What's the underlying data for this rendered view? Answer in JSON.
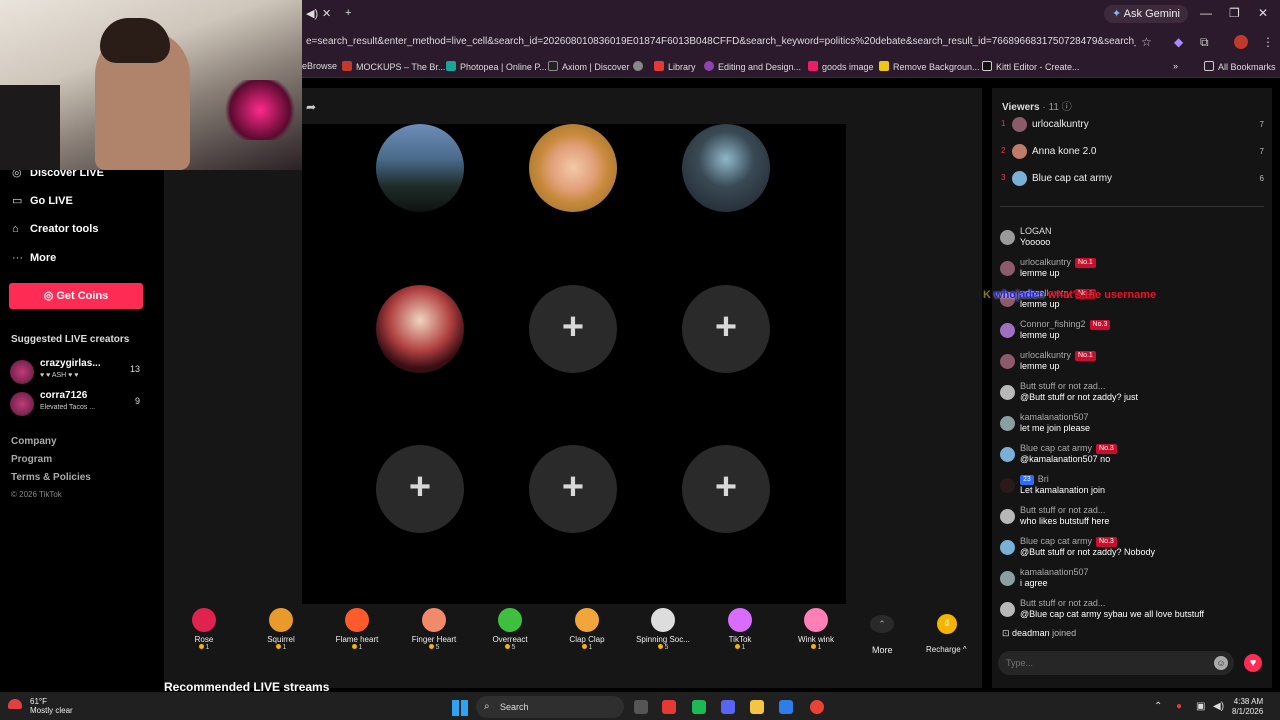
{
  "browser": {
    "url": "e=search_result&enter_method=live_cell&search_id=202608010836019E01874F6013B048CFFD&search_keyword=politics%20debate&search_result_id=7668966831750728479&search_type=live",
    "gemini_label": "Ask Gemini",
    "bookmarks": [
      {
        "label": "eBrowse",
        "color": ""
      },
      {
        "label": "MOCKUPS – The Br...",
        "color": "#c0392b"
      },
      {
        "label": "Photopea | Online P...",
        "color": "#18a497"
      },
      {
        "label": "Axiom | Discover",
        "color": "#222222"
      },
      {
        "label": "",
        "color": "#888888"
      },
      {
        "label": "Library",
        "color": "#e53935"
      },
      {
        "label": "Editing and Design...",
        "color": "#8e44ad"
      },
      {
        "label": "goods image",
        "color": "#e91e63"
      },
      {
        "label": "Remove Backgroun...",
        "color": "#f1c40f"
      },
      {
        "label": "Kittl Editor - Create...",
        "color": "#111111"
      }
    ],
    "all_bookmarks": "All Bookmarks"
  },
  "sidebar": {
    "nav": [
      {
        "icon": "broadcast-icon",
        "glyph": "◎",
        "label": "Discover LIVE"
      },
      {
        "icon": "camera-icon",
        "glyph": "▭",
        "label": "Go LIVE"
      },
      {
        "icon": "home-icon",
        "glyph": "⌂",
        "label": "Creator tools"
      },
      {
        "icon": "more-icon",
        "glyph": "···",
        "label": "More"
      }
    ],
    "coins_label": "Get Coins",
    "suggested_title": "Suggested LIVE creators",
    "creators": [
      {
        "name": "crazygirlas...",
        "sub": "♥ ♥ ASH ♥ ♥",
        "count": "13"
      },
      {
        "name": "corra7126",
        "sub": "Elevated Tacos ...",
        "count": "9"
      }
    ],
    "footer": [
      "Company",
      "Program",
      "Terms & Policies"
    ],
    "copyright": "© 2026 TikTok"
  },
  "stage": {
    "slots_filled": 4,
    "slots_empty": 5,
    "plus": "+"
  },
  "gifts": [
    {
      "name": "Rose",
      "price": "1",
      "color": "#e0234e"
    },
    {
      "name": "Squirrel",
      "price": "1",
      "color": "#e89a2c"
    },
    {
      "name": "Flame heart",
      "price": "1",
      "color": "#ff5a2c"
    },
    {
      "name": "Finger Heart",
      "price": "5",
      "color": "#f08a6a"
    },
    {
      "name": "Overreact",
      "price": "5",
      "color": "#3fbf3f"
    },
    {
      "name": "Clap Clap",
      "price": "1",
      "color": "#f2a53a"
    },
    {
      "name": "Spinning Soc...",
      "price": "5",
      "color": "#dddddd"
    },
    {
      "name": "TikTok",
      "price": "1",
      "color": "#d76cff"
    },
    {
      "name": "Wink wink",
      "price": "1",
      "color": "#ff7fb6"
    }
  ],
  "gift_more": "More",
  "recharge": "Recharge ^",
  "recommended": "Recommended LIVE streams",
  "viewers": {
    "title": "Viewers",
    "count": "· 11",
    "info": "ⓘ",
    "list": [
      {
        "rank": "1",
        "name": "urlocalkuntry",
        "score": "7",
        "color": "#8d5a6a"
      },
      {
        "rank": "2",
        "name": "Anna kone 2.0",
        "score": "7",
        "color": "#c07a6a"
      },
      {
        "rank": "3",
        "name": "Blue cap cat army",
        "score": "6",
        "color": "#7ab0d8"
      }
    ]
  },
  "chat": [
    {
      "user": "LOGAN",
      "badge": "",
      "text": "Yooooo",
      "color": "#9a9a9a"
    },
    {
      "user": "urlocalkuntry",
      "badge": "No.1",
      "text": "lemme up",
      "color": "#8d5a6a"
    },
    {
      "user": "urlocalkuntry",
      "badge": "No.1",
      "text": "lemme up",
      "color": "#8d5a6a"
    },
    {
      "user": "Connor_fishing2",
      "badge": "No.3",
      "text": "lemme up",
      "color": "#a070c0"
    },
    {
      "user": "urlocalkuntry",
      "badge": "No.1",
      "text": "lemme up",
      "color": "#8d5a6a"
    },
    {
      "user": "Butt stuff or not zad...",
      "badge": "",
      "text": "@Butt stuff or not zaddy? just",
      "color": "#b8b8b8"
    },
    {
      "user": "kamalanation507",
      "badge": "",
      "text": "let me join please",
      "color": "#8aa0a0"
    },
    {
      "user": "Blue cap cat army",
      "badge": "No.3",
      "text": "@kamalanation507 no",
      "color": "#7ab0d8"
    },
    {
      "user": "Bri",
      "badge": "23",
      "text": "Let kamalanation join",
      "color": "#2a1a1a"
    },
    {
      "user": "Butt stuff or not zad...",
      "badge": "",
      "text": "who likes butstuff here",
      "color": "#b8b8b8"
    },
    {
      "user": "Blue cap cat army",
      "badge": "No.3",
      "text": "@Butt stuff or not zaddy? Nobody",
      "color": "#7ab0d8"
    },
    {
      "user": "kamalanation507",
      "badge": "",
      "text": "i agree",
      "color": "#8aa0a0"
    },
    {
      "user": "Butt stuff or not zad...",
      "badge": "",
      "text": "@Blue cap cat army sybau we all love butstuff",
      "color": "#b8b8b8"
    }
  ],
  "overlay": {
    "k": "K",
    "name": "whojaden",
    "text": "what's the username"
  },
  "joined": {
    "user": "deadman",
    "text": "joined"
  },
  "type_placeholder": "Type...",
  "taskbar": {
    "temp": "61°F",
    "weather": "Mostly clear",
    "search": "Search",
    "time": "4:38 AM",
    "date": "8/1/2026"
  }
}
